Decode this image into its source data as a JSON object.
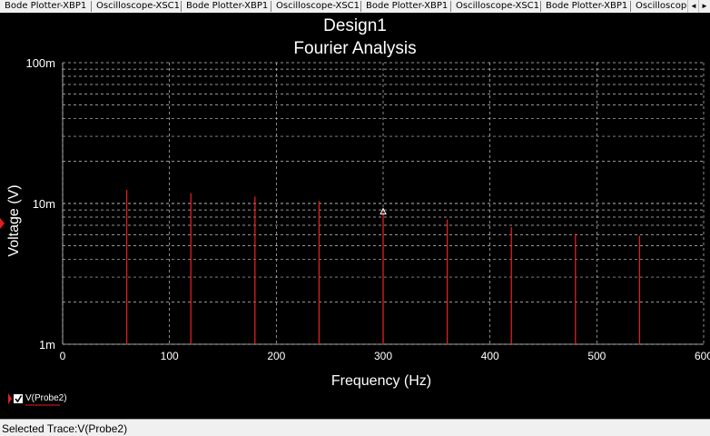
{
  "tabs": [
    {
      "label": "Bode Plotter-XBP1"
    },
    {
      "label": "Oscilloscope-XSC1"
    },
    {
      "label": "Bode Plotter-XBP1"
    },
    {
      "label": "Oscilloscope-XSC1"
    },
    {
      "label": "Bode Plotter-XBP1"
    },
    {
      "label": "Oscilloscope-XSC1"
    },
    {
      "label": "Bode Plotter-XBP1"
    },
    {
      "label": "Oscilloscop"
    }
  ],
  "scroll": {
    "left_icon": "◄",
    "right_icon": "►"
  },
  "chart": {
    "title_line1": "Design1",
    "title_line2": "Fourier Analysis",
    "xlabel": "Frequency (Hz)",
    "ylabel": "Voltage (V)",
    "x_ticks": [
      "0",
      "100",
      "200",
      "300",
      "400",
      "500",
      "600"
    ],
    "y_ticks": [
      "100m",
      "10m",
      "1m"
    ],
    "legend_label": "V(Probe2)",
    "colors": {
      "background": "#000000",
      "trace": "#e02020",
      "text": "#ffffff",
      "grid": "#c8c8c8"
    }
  },
  "chart_data": {
    "type": "bar",
    "title": "Design1 Fourier Analysis",
    "xlabel": "Frequency (Hz)",
    "ylabel": "Voltage (V)",
    "yscale": "log",
    "xlim": [
      0,
      600
    ],
    "ylim": [
      0.001,
      0.1
    ],
    "grid": true,
    "series": [
      {
        "name": "V(Probe2)",
        "x": [
          60,
          120,
          180,
          240,
          300,
          360,
          420,
          480,
          540
        ],
        "values": [
          0.0125,
          0.0118,
          0.0112,
          0.0104,
          0.0088,
          0.0077,
          0.0068,
          0.0061,
          0.0059
        ]
      }
    ],
    "marker": {
      "x": 300,
      "y": 0.0088
    }
  },
  "statusbar": {
    "text": "Selected Trace:V(Probe2)"
  }
}
